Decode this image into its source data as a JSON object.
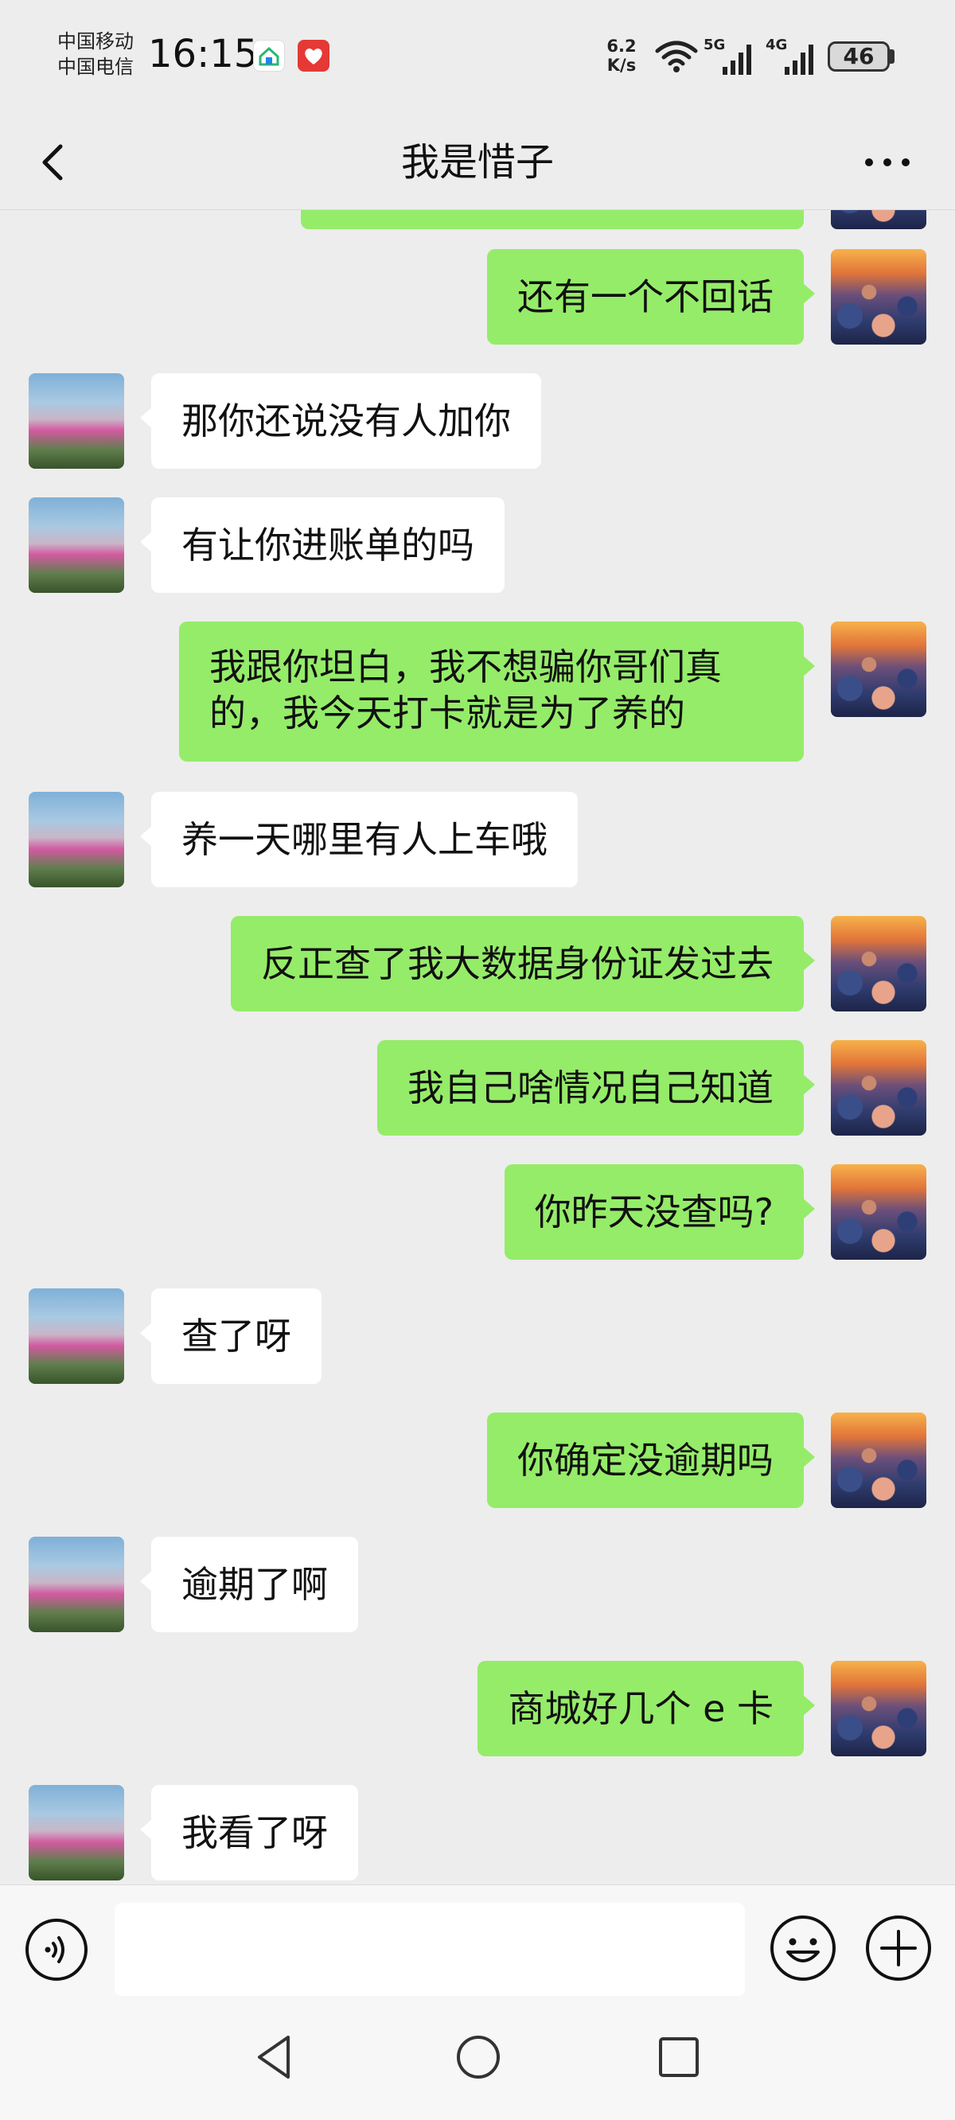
{
  "status_bar": {
    "carrier_1": "中国移动",
    "carrier_2": "中国电信",
    "time": "16:15",
    "net_speed_value": "6.2",
    "net_speed_unit": "K/s",
    "signal_1": "5G",
    "signal_2": "4G",
    "battery": "46"
  },
  "header": {
    "title": "我是惜子",
    "back_icon": "chevron-left-icon",
    "more_icon": "more-dots-icon"
  },
  "messages": [
    {
      "side": "out",
      "text": ""
    },
    {
      "side": "out",
      "text": "还有一个不回话"
    },
    {
      "side": "in",
      "text": "那你还说没有人加你"
    },
    {
      "side": "in",
      "text": "有让你进账单的吗"
    },
    {
      "side": "out",
      "text": "我跟你坦白，我不想骗你哥们真的，我今天打卡就是为了养的"
    },
    {
      "side": "in",
      "text": "养一天哪里有人上车哦"
    },
    {
      "side": "out",
      "text": "反正查了我大数据身份证发过去"
    },
    {
      "side": "out",
      "text": "我自己啥情况自己知道"
    },
    {
      "side": "out",
      "text": "你昨天没查吗?"
    },
    {
      "side": "in",
      "text": "查了呀"
    },
    {
      "side": "out",
      "text": "你确定没逾期吗"
    },
    {
      "side": "in",
      "text": "逾期了啊"
    },
    {
      "side": "out",
      "text": "商城好几个 e 卡"
    },
    {
      "side": "in",
      "text": "我看了呀"
    }
  ],
  "input_bar": {
    "voice_icon": "voice-icon",
    "message_value": "",
    "emoji_icon": "emoji-icon",
    "plus_icon": "plus-icon"
  },
  "nav_bar": {
    "back_icon": "nav-back-icon",
    "home_icon": "nav-home-icon",
    "recent_icon": "nav-recent-icon"
  },
  "colors": {
    "background": "#ededed",
    "outgoing_bubble": "#95ec69",
    "incoming_bubble": "#ffffff"
  }
}
